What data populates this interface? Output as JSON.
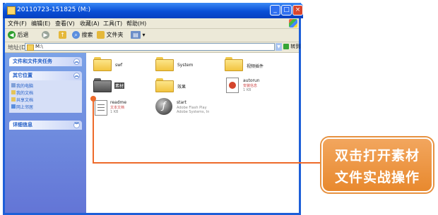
{
  "window": {
    "title": "20110723-151825 (M:)",
    "buttons": {
      "minimize": "_",
      "maximize": "□",
      "close": "×"
    }
  },
  "menubar": {
    "items": [
      "文件(F)",
      "编辑(E)",
      "查看(V)",
      "收藏(A)",
      "工具(T)",
      "帮助(H)"
    ]
  },
  "toolbar": {
    "back_label": "后退",
    "search_label": "搜索",
    "folders_label": "文件夹"
  },
  "addressbar": {
    "label": "地址(D)",
    "value": "M:\\",
    "go_label": "转到"
  },
  "sidebar": {
    "panels": [
      {
        "title": "文件和文件夹任务",
        "items": []
      },
      {
        "title": "其它位置",
        "items": [
          "我的电脑",
          "我的文档",
          "共享文档",
          "网上邻居"
        ]
      },
      {
        "title": "详细信息",
        "items": []
      }
    ]
  },
  "content": {
    "items": [
      {
        "name": "swf",
        "kind": "folder"
      },
      {
        "name": "System",
        "kind": "folder"
      },
      {
        "name": "视频插件",
        "kind": "folder"
      },
      {
        "name": "素材",
        "kind": "folder",
        "selected": true
      },
      {
        "name": "效果",
        "kind": "folder"
      },
      {
        "name": "autorun",
        "kind": "setup",
        "sub1": "安装信息",
        "sub2": "1 KB"
      },
      {
        "name": "readme",
        "kind": "text",
        "sub1": "文本文档",
        "sub2": "1 KB"
      },
      {
        "name": "start",
        "kind": "flash",
        "sub1": "Adobe Flash Play",
        "sub2": "Adobe Systems, In"
      }
    ]
  },
  "callout": {
    "line1": "双击打开素材",
    "line2": "文件实战操作",
    "color": "#e8892e"
  }
}
